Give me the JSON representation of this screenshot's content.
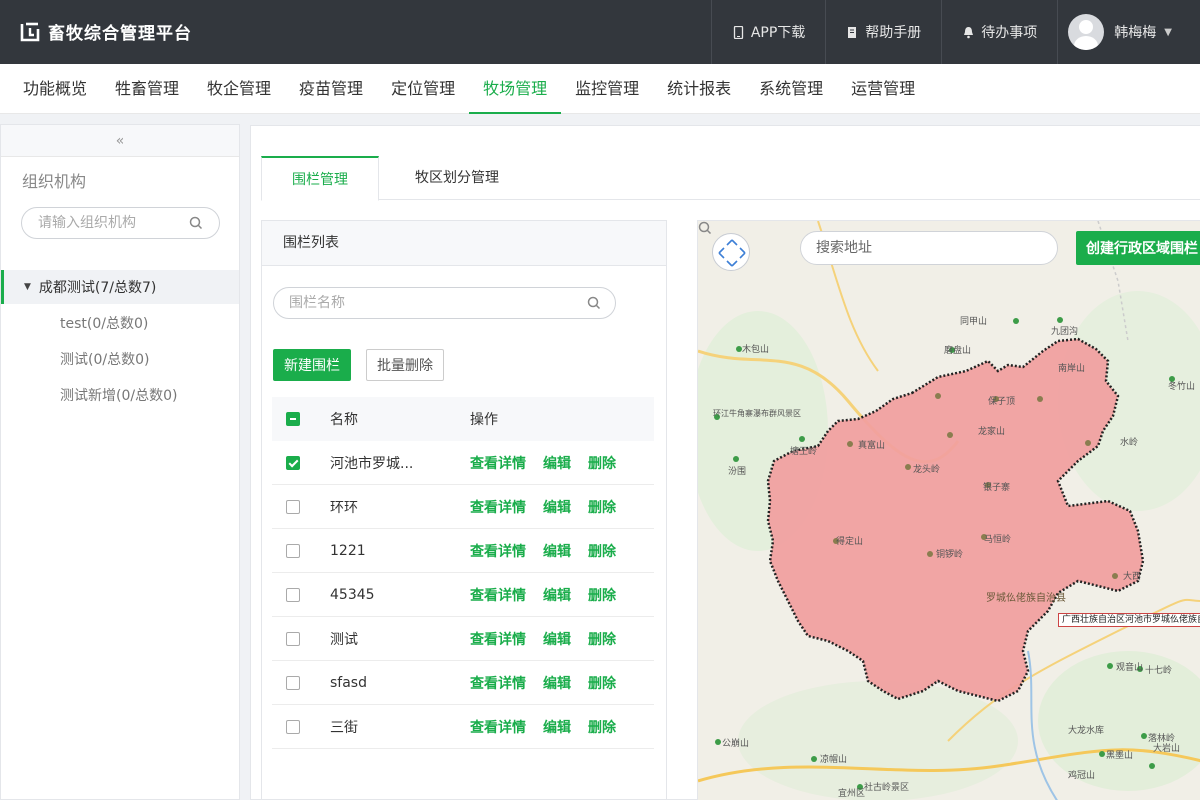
{
  "app": {
    "title": "畜牧综合管理平台"
  },
  "header": {
    "actions": [
      {
        "label": "APP下载",
        "icon": "phone-icon"
      },
      {
        "label": "帮助手册",
        "icon": "book-icon"
      },
      {
        "label": "待办事项",
        "icon": "bell-icon"
      }
    ],
    "user": {
      "name": "韩梅梅"
    }
  },
  "nav": {
    "items": [
      "功能概览",
      "牲畜管理",
      "牧企管理",
      "疫苗管理",
      "定位管理",
      "牧场管理",
      "监控管理",
      "统计报表",
      "系统管理",
      "运营管理"
    ],
    "active_index": 5
  },
  "sidebar": {
    "collapse_label": "«",
    "title": "组织机构",
    "search_placeholder": "请输入组织机构",
    "tree": {
      "root": "成都测试(7/总数7)",
      "children": [
        "test(0/总数0)",
        "测试(0/总数0)",
        "测试新增(0/总数0)"
      ]
    }
  },
  "tabs": [
    "围栏管理",
    "牧区划分管理"
  ],
  "fence_list": {
    "title": "围栏列表",
    "search_placeholder": "围栏名称",
    "new_button": "新建围栏",
    "batch_delete_button": "批量删除",
    "columns": {
      "name": "名称",
      "ops": "操作"
    },
    "actions": {
      "view": "查看详情",
      "edit": "编辑",
      "delete": "删除"
    },
    "rows": [
      {
        "name": "河池市罗城...",
        "checked": true
      },
      {
        "name": "环环",
        "checked": false
      },
      {
        "name": "1221",
        "checked": false
      },
      {
        "name": "45345",
        "checked": false
      },
      {
        "name": "测试",
        "checked": false
      },
      {
        "name": "sfasd",
        "checked": false
      },
      {
        "name": "三街",
        "checked": false
      }
    ]
  },
  "map": {
    "search_placeholder": "搜索地址",
    "admin_fence_button": "创建行政区域围栏",
    "tooltip": "广西壮族自治区河池市罗城仫佬族自治县",
    "fence_color": "#f19e9e",
    "labels": {
      "county": "罗城仫佬族自治县",
      "places": [
        "九团沟",
        "同甲山",
        "磨盘山",
        "保子顶",
        "龙家山",
        "真富山",
        "龙头岭",
        "银子寨",
        "马恒岭",
        "得定山",
        "铜锣岭",
        "水岭",
        "大西",
        "冬竹山",
        "木包山",
        "环江牛角寨瀑布群风景区",
        "塘王岭",
        "汾围",
        "观音山",
        "十七岭",
        "凉帽山",
        "公崩山",
        "大龙水库",
        "黑墨山",
        "大岩山",
        "落林岭",
        "鸡冠山",
        "社古岭景区",
        "宜州区",
        "南岸山"
      ]
    }
  },
  "colors": {
    "accent": "#1aad4b",
    "header_bg": "#33373d"
  }
}
